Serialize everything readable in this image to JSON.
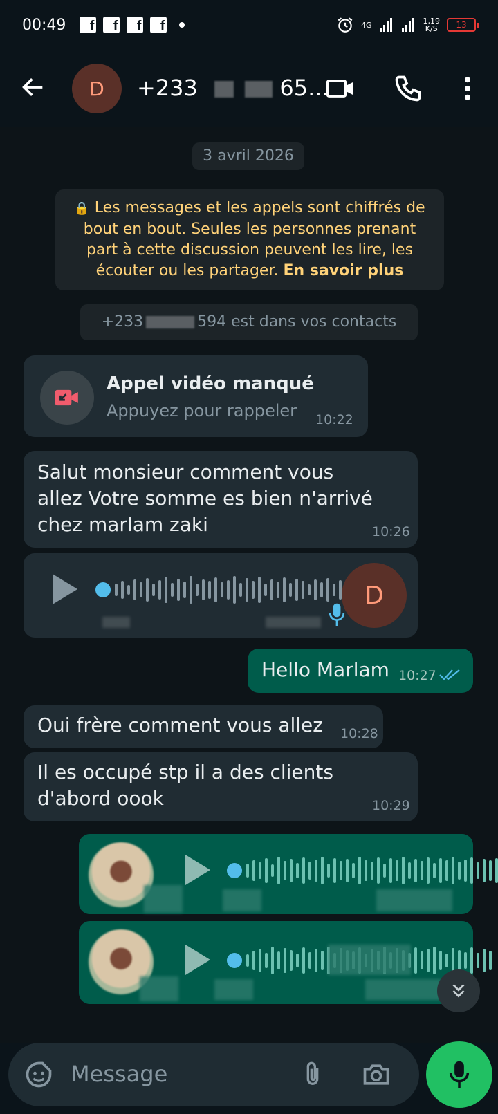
{
  "status_bar": {
    "time": "00:49",
    "fb_icons": [
      "f",
      "f",
      "f",
      "f"
    ],
    "network": "4G",
    "speed_value": "1,19",
    "speed_unit": "K/S",
    "battery": "13"
  },
  "header": {
    "avatar_letter": "D",
    "contact_prefix": "+233",
    "contact_tail": "65...",
    "icons": [
      "back-arrow-icon",
      "video-call-icon",
      "phone-icon",
      "more-vert-icon"
    ]
  },
  "chat": {
    "date_chip": "3 avril 2026",
    "encryption_notice": "Les messages et les appels sont chiffrés de bout en bout. Seules les personnes prenant part à cette discussion peuvent les lire, les écouter ou les partager.",
    "encryption_link": "En savoir plus",
    "contact_notice_prefix": "+233",
    "contact_notice_suffix": "594 est dans vos contacts",
    "missed_call": {
      "title": "Appel vidéo manqué",
      "subtitle": "Appuyez pour rappeler",
      "time": "10:22"
    },
    "messages": [
      {
        "direction": "in",
        "text": "Salut monsieur comment vous allez Votre somme es bien n'arrivé  chez marlam zaki",
        "time": "10:26"
      },
      {
        "direction": "in",
        "type": "voice",
        "avatar_letter": "D"
      },
      {
        "direction": "out",
        "text": "Hello Marlam",
        "time": "10:27",
        "status": "read"
      },
      {
        "direction": "in",
        "text": "Oui frère comment vous allez",
        "time": "10:28"
      },
      {
        "direction": "in",
        "text": "Il es occupé stp il a des clients d'abord oook",
        "time": "10:29"
      },
      {
        "direction": "out",
        "type": "voice"
      },
      {
        "direction": "out",
        "type": "voice"
      }
    ]
  },
  "input": {
    "placeholder": "Message"
  },
  "colors": {
    "background": "#0b141a",
    "incoming_bubble": "#202c33",
    "outgoing_bubble": "#005c4b",
    "accent_green": "#21c063",
    "encryption_text": "#ffd279",
    "read_ticks": "#53bdeb"
  }
}
